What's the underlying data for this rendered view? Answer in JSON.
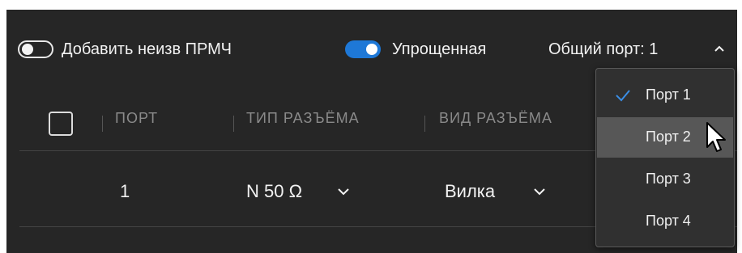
{
  "toolbar": {
    "add_toggle": {
      "label": "Добавить неизв ПРМЧ",
      "on": false
    },
    "simple_toggle": {
      "label": "Упрощенная",
      "on": true
    },
    "common_port": {
      "label": "Общий порт: 1"
    }
  },
  "table": {
    "headers": [
      "ПОРТ",
      "ТИП РАЗЪЁМА",
      "ВИД РАЗЪЁМА"
    ],
    "rows": [
      {
        "port": "1",
        "connector_type": "N 50 Ω",
        "connector_kind": "Вилка"
      }
    ]
  },
  "dropdown": {
    "options": [
      "Порт 1",
      "Порт 2",
      "Порт 3",
      "Порт 4"
    ],
    "selected": "Порт 1",
    "hovered": "Порт 2"
  },
  "colors": {
    "panel_bg": "#262626",
    "accent": "#1e78d7",
    "hover_bg": "#575757",
    "header_text": "#8a8a8a"
  }
}
